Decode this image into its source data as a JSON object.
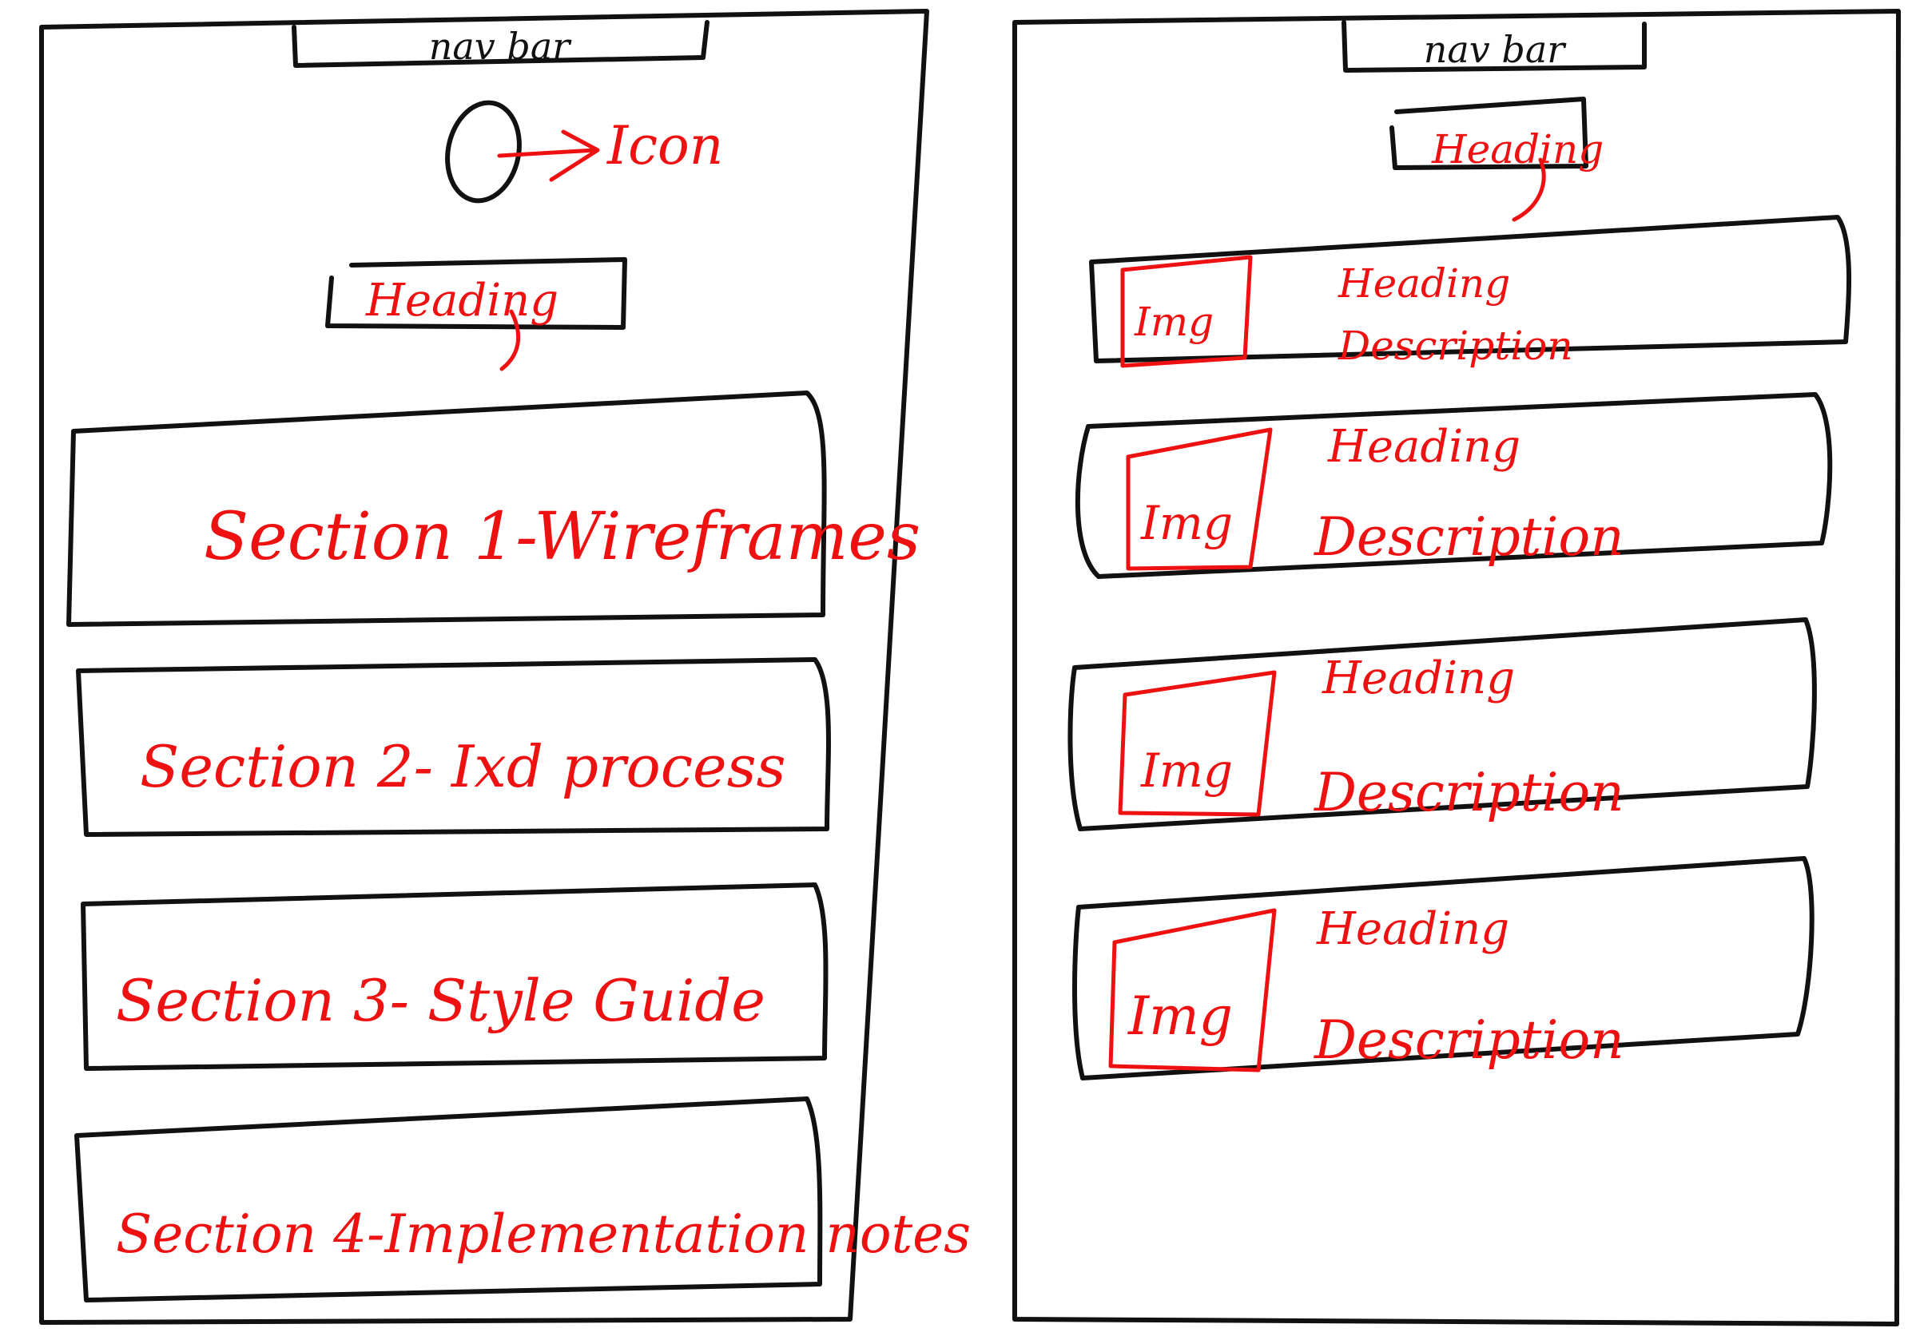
{
  "colors": {
    "ink": "#111111",
    "annotation": "#ee1111",
    "paper": "#ffffff"
  },
  "left_screen": {
    "nav_bar": "nav bar",
    "icon_label": "Icon",
    "heading": "Heading",
    "sections": [
      "Section 1-Wireframes",
      "Section 2- Ixd process",
      "Section 3- Style Guide",
      "Section 4-Implementation notes"
    ]
  },
  "right_screen": {
    "nav_bar": "nav bar",
    "heading": "Heading",
    "cards": [
      {
        "img": "Img",
        "heading": "Heading",
        "description": "Description"
      },
      {
        "img": "Img",
        "heading": "Heading",
        "description": "Description"
      },
      {
        "img": "Img",
        "heading": "Heading",
        "description": "Description"
      },
      {
        "img": "Img",
        "heading": "Heading",
        "description": "Description"
      }
    ]
  }
}
